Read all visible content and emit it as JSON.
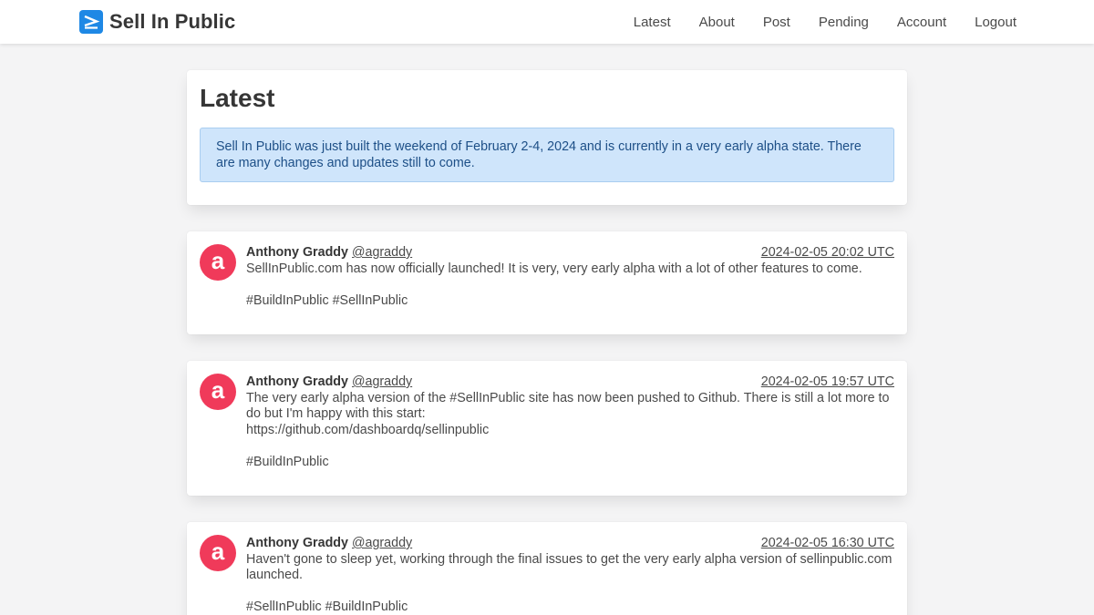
{
  "brand": {
    "name": "Sell In Public",
    "logo_icon": "terminal-chevron-icon",
    "logo_color": "#1e88e5"
  },
  "nav": [
    {
      "label": "Latest"
    },
    {
      "label": "About"
    },
    {
      "label": "Post"
    },
    {
      "label": "Pending"
    },
    {
      "label": "Account"
    },
    {
      "label": "Logout"
    }
  ],
  "page": {
    "title": "Latest",
    "notice": "Sell In Public was just built the weekend of February 2-4, 2024 and is currently in a very early alpha state. There are many changes and updates still to come."
  },
  "posts": [
    {
      "avatar_letter": "a",
      "avatar_color": "#f03a5a",
      "author": "Anthony Graddy",
      "handle": "@agraddy",
      "timestamp": "2024-02-05 20:02 UTC",
      "text": "SellInPublic.com has now officially launched! It is very, very early alpha with a lot of other features to come.\n\n#BuildInPublic #SellInPublic"
    },
    {
      "avatar_letter": "a",
      "avatar_color": "#f03a5a",
      "author": "Anthony Graddy",
      "handle": "@agraddy",
      "timestamp": "2024-02-05 19:57 UTC",
      "text": "The very early alpha version of the #SellInPublic site has now been pushed to Github. There is still a lot more to do but I'm happy with this start:\nhttps://github.com/dashboardq/sellinpublic\n\n#BuildInPublic"
    },
    {
      "avatar_letter": "a",
      "avatar_color": "#f03a5a",
      "author": "Anthony Graddy",
      "handle": "@agraddy",
      "timestamp": "2024-02-05 16:30 UTC",
      "text": "Haven't gone to sleep yet, working through the final issues to get the very early alpha version of sellinpublic.com launched.\n\n#SellInPublic #BuildInPublic"
    }
  ]
}
